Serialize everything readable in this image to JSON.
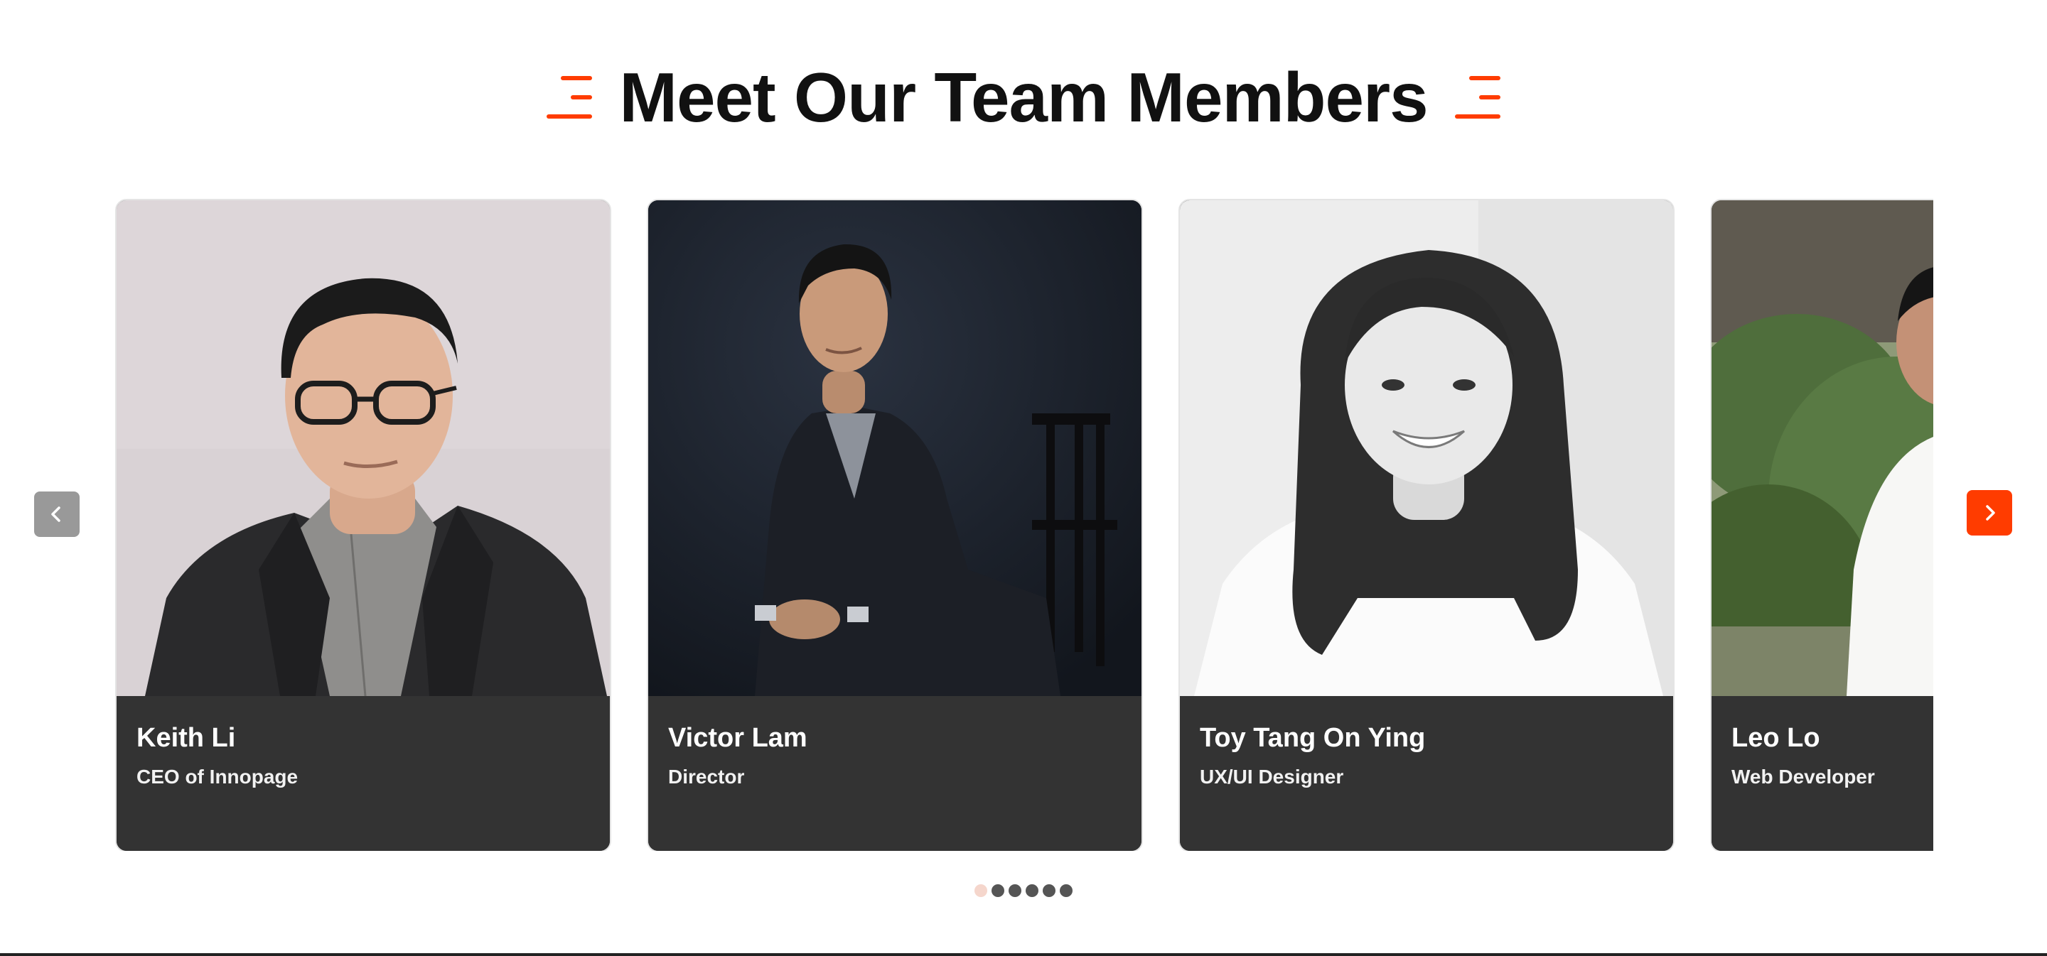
{
  "colors": {
    "accent": "#ff3c00",
    "card_bg": "#333333",
    "heading": "#111111",
    "arrow_inactive": "#999999",
    "dot_active": "#f5d6cc",
    "dot_inactive": "#555555"
  },
  "section": {
    "title": "Meet Our Team Members",
    "decoration_icon": "three-lines-icon"
  },
  "carousel": {
    "prev_icon": "chevron-left-icon",
    "next_icon": "chevron-right-icon",
    "active_page": 1,
    "page_count": 6,
    "members": [
      {
        "name": "Keith Li",
        "role": "CEO of Innopage",
        "photo": "man-glasses-dark-blazer-photo"
      },
      {
        "name": "Victor Lam",
        "role": "Director",
        "photo": "man-dark-suit-seated-chair-photo"
      },
      {
        "name": "Toy Tang On Ying",
        "role": "UX/UI Designer",
        "photo": "woman-long-hair-white-tee-photo"
      },
      {
        "name": "Leo Lo",
        "role": "Web Developer",
        "photo": "man-white-tee-outdoor-photo"
      }
    ]
  }
}
